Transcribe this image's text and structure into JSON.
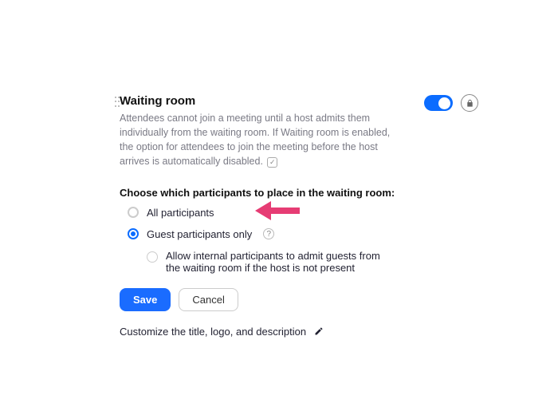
{
  "section": {
    "title": "Waiting room",
    "description": "Attendees cannot join a meeting until a host admits them individually from the waiting room. If Waiting room is enabled, the option for attendees to join the meeting before the host arrives is automatically disabled.",
    "toggle_on": true
  },
  "subhead": "Choose which participants to place in the waiting room:",
  "options": {
    "all": {
      "label": "All participants",
      "selected": false
    },
    "guest": {
      "label": "Guest participants only",
      "selected": true
    },
    "allow_internal": {
      "label": "Allow internal participants to admit guests from the waiting room if the host is not present",
      "checked": false
    }
  },
  "buttons": {
    "save": "Save",
    "cancel": "Cancel"
  },
  "customize": {
    "label": "Customize the title, logo, and description"
  },
  "colors": {
    "accent": "#0b6cff",
    "annotation": "#e63c74"
  }
}
